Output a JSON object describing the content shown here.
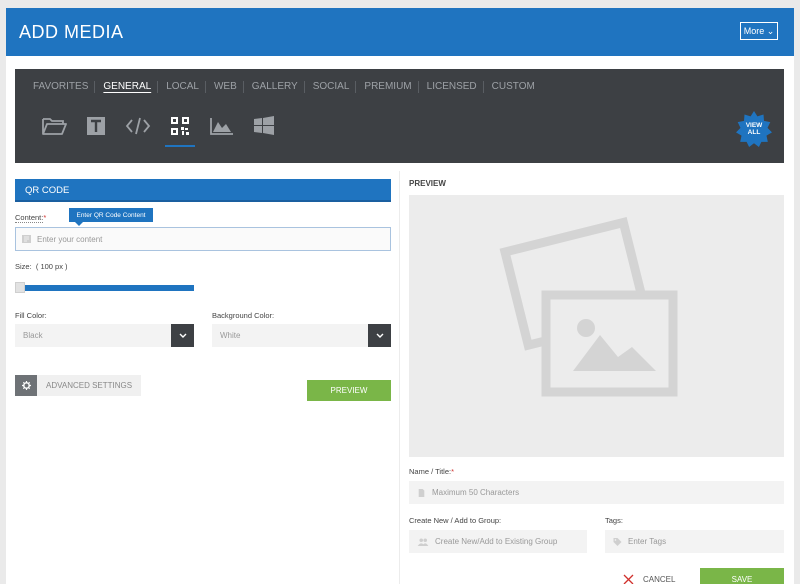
{
  "header": {
    "title": "ADD MEDIA",
    "more_label": "More ⌄"
  },
  "tabs": [
    {
      "label": "FAVORITES",
      "active": false
    },
    {
      "label": "GENERAL",
      "active": true
    },
    {
      "label": "LOCAL",
      "active": false
    },
    {
      "label": "WEB",
      "active": false
    },
    {
      "label": "GALLERY",
      "active": false
    },
    {
      "label": "SOCIAL",
      "active": false
    },
    {
      "label": "PREMIUM",
      "active": false
    },
    {
      "label": "LICENSED",
      "active": false
    },
    {
      "label": "CUSTOM",
      "active": false
    }
  ],
  "source_icons": [
    "folder-icon",
    "text-icon",
    "code-icon",
    "qr-code-icon",
    "chart-icon",
    "windows-icon"
  ],
  "view_all": {
    "line1": "VIEW",
    "line2": "ALL"
  },
  "qr": {
    "section_title": "QR CODE",
    "content_label": "Content:",
    "required_mark": "*",
    "tooltip": "Enter QR Code Content",
    "content_placeholder": "Enter your content",
    "size_label": "Size:",
    "size_value": "( 100 px )",
    "size_slider_level": 0,
    "fill_color_label": "Fill Color:",
    "fill_color_value": "Black",
    "bg_color_label": "Background Color:",
    "bg_color_value": "White",
    "advanced_label": "ADVANCED SETTINGS",
    "preview_button": "PREVIEW"
  },
  "preview": {
    "title": "PREVIEW",
    "name_label": "Name / Title:",
    "name_placeholder": "Maximum 50 Characters",
    "group_label": "Create New / Add to Group:",
    "group_placeholder": "Create New/Add to Existing Group",
    "tags_label": "Tags:",
    "tags_placeholder": "Enter Tags"
  },
  "footer": {
    "cancel_label": "CANCEL",
    "save_label": "SAVE"
  },
  "colors": {
    "primary": "#1f74c0",
    "dark": "#3d4044",
    "green": "#7ab648",
    "required": "#d0312d"
  }
}
